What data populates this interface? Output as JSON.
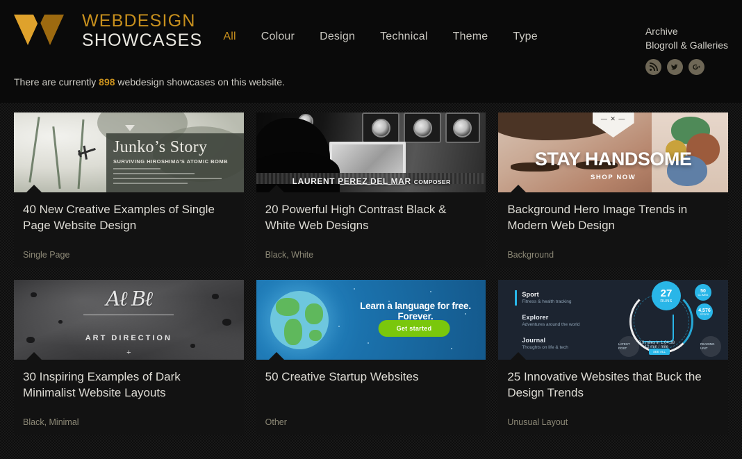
{
  "header": {
    "brand_line1": "WEBDESIGN",
    "brand_line2": "SHOWCASES",
    "logo_icon": "w-logo-icon",
    "nav": [
      {
        "label": "All",
        "active": true
      },
      {
        "label": "Colour",
        "active": false
      },
      {
        "label": "Design",
        "active": false
      },
      {
        "label": "Technical",
        "active": false
      },
      {
        "label": "Theme",
        "active": false
      },
      {
        "label": "Type",
        "active": false
      }
    ],
    "archive_link": "Archive",
    "blogroll_link": "Blogroll & Galleries",
    "socials": [
      {
        "name": "rss-icon",
        "glyph": "RSS"
      },
      {
        "name": "twitter-icon",
        "glyph": "t"
      },
      {
        "name": "google-plus-icon",
        "glyph": "g+"
      }
    ],
    "counter_prefix": "There are currently",
    "counter_value": "898",
    "counter_suffix": "webdesign showcases on this website.",
    "accent_color": "#c8901d"
  },
  "cards": [
    {
      "title": "40 New Creative Examples of Single Page Website Design",
      "tag": "Single Page",
      "thumb": {
        "kind": "junko",
        "headline": "Junko’s Story",
        "subhead": "SURVIVING HIROSHIMA’S ATOMIC BOMB"
      }
    },
    {
      "title": "20 Powerful High Contrast Black & White Web Designs",
      "tag": "Black, White",
      "thumb": {
        "kind": "laurent",
        "caption": "LAURENT PEREZ DEL MAR",
        "caption_small": "COMPOSER"
      }
    },
    {
      "title": "Background Hero Image Trends in Modern Web Design",
      "tag": "Background",
      "thumb": {
        "kind": "handsome",
        "headline": "STAY HANDSOME",
        "cta": "SHOP NOW",
        "badge": "— ✕ —"
      }
    },
    {
      "title": "30 Inspiring Examples of Dark Minimalist Website Layouts",
      "tag": "Black, Minimal",
      "thumb": {
        "kind": "artdirection",
        "signature": "Aℓ Bℓ",
        "headline": "ART DIRECTION",
        "plus": "+"
      }
    },
    {
      "title": "50 Creative Startup Websites",
      "tag": "Other",
      "thumb": {
        "kind": "duolingo",
        "headline": "Learn a language for free. Forever.",
        "button": "Get started"
      }
    },
    {
      "title": "25 Innovative Websites that Buck the Design Trends",
      "tag": "Unusual Layout",
      "thumb": {
        "kind": "dashboard",
        "menu": [
          {
            "title": "Sport",
            "sub": "Fitness & health tracking"
          },
          {
            "title": "Explorer",
            "sub": "Adventures around the world"
          },
          {
            "title": "Journal",
            "sub": "Thoughts on life & tech"
          }
        ],
        "gauge_value": "27",
        "gauge_label": "RUNS",
        "badge1_value": "50",
        "badge1_label": "CLIMBS",
        "badge2_value": "4,576",
        "badge2_label": "STEPS",
        "stat": "8.9 miles in 1:04:38",
        "stat_sub": "12 min / mile",
        "pill": "SEE ALL",
        "circle_left": "LATEST POST",
        "circle_right": "READING UNIT"
      }
    }
  ]
}
